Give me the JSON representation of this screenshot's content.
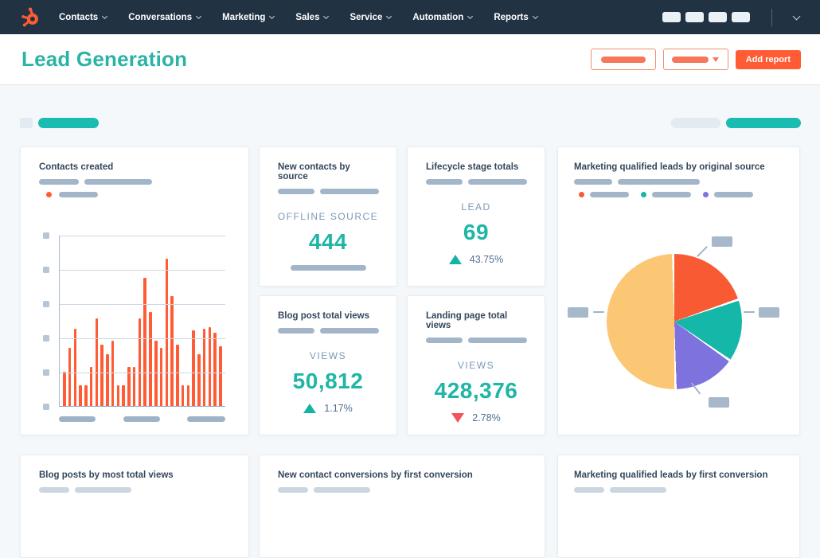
{
  "nav": {
    "items": [
      {
        "label": "Contacts"
      },
      {
        "label": "Conversations"
      },
      {
        "label": "Marketing"
      },
      {
        "label": "Sales"
      },
      {
        "label": "Service"
      },
      {
        "label": "Automation"
      },
      {
        "label": "Reports"
      }
    ],
    "icon_placeholder_count": 4
  },
  "header": {
    "title": "Lead Generation",
    "add_report_label": "Add report"
  },
  "cards": {
    "contacts_created": {
      "title": "Contacts created"
    },
    "new_contacts_by_source": {
      "title": "New contacts by source",
      "metric_label": "OFFLINE SOURCE",
      "value": "444"
    },
    "lifecycle_stage_totals": {
      "title": "Lifecycle stage totals",
      "metric_label": "LEAD",
      "value": "69",
      "delta": "43.75%",
      "delta_direction": "up"
    },
    "blog_post_total_views": {
      "title": "Blog post total views",
      "metric_label": "VIEWS",
      "value": "50,812",
      "delta": "1.17%",
      "delta_direction": "up"
    },
    "landing_page_total_views": {
      "title": "Landing page total views",
      "metric_label": "VIEWS",
      "value": "428,376",
      "delta": "2.78%",
      "delta_direction": "down"
    },
    "mql_by_original_source": {
      "title": "Marketing qualified leads by original source"
    },
    "blog_posts_by_most_total_views": {
      "title": "Blog posts by most total views"
    },
    "new_contact_conversions_by_first_conversion": {
      "title": "New contact conversions by first conversion"
    },
    "mql_by_first_conversion": {
      "title": "Marketing qualified leads by first conversion"
    }
  },
  "colors": {
    "nav_background": "#213343",
    "accent_orange": "#ff5c35",
    "teal_text": "#1fb6a6",
    "teal_pill": "#1abcb1",
    "delta_up": "#12b5a2",
    "delta_down": "#f2545b"
  },
  "chart_data": [
    {
      "type": "bar",
      "title": "Contacts created",
      "note": "daily new-contact counts; axis tick and x-axis labels are blurred placeholders in the mock",
      "values": [
        20,
        34,
        45,
        12,
        12,
        23,
        51,
        36,
        30,
        38,
        12,
        12,
        23,
        23,
        51,
        75,
        55,
        38,
        34,
        86,
        64,
        36,
        12,
        12,
        44,
        30,
        45,
        46,
        43,
        35
      ],
      "ylim": [
        0,
        100
      ],
      "y_ticks": 6,
      "gridlines": 5,
      "grid": true,
      "color": "#ff5c35",
      "legend": "single series, orange dot with placeholder label"
    },
    {
      "type": "pie",
      "title": "Marketing qualified leads by original source",
      "note": "slice callout labels and legend labels are blurred placeholders in the mock",
      "slices": [
        {
          "name": "segment-1",
          "color": "#f85b33",
          "pct": 20
        },
        {
          "name": "segment-2",
          "color": "#15b7a8",
          "pct": 15
        },
        {
          "name": "segment-3",
          "color": "#7d72de",
          "pct": 15
        },
        {
          "name": "segment-4",
          "color": "#fbc775",
          "pct": 50
        }
      ],
      "legend_entries": 3,
      "callout_labels": 4,
      "legend_position": "top"
    }
  ]
}
